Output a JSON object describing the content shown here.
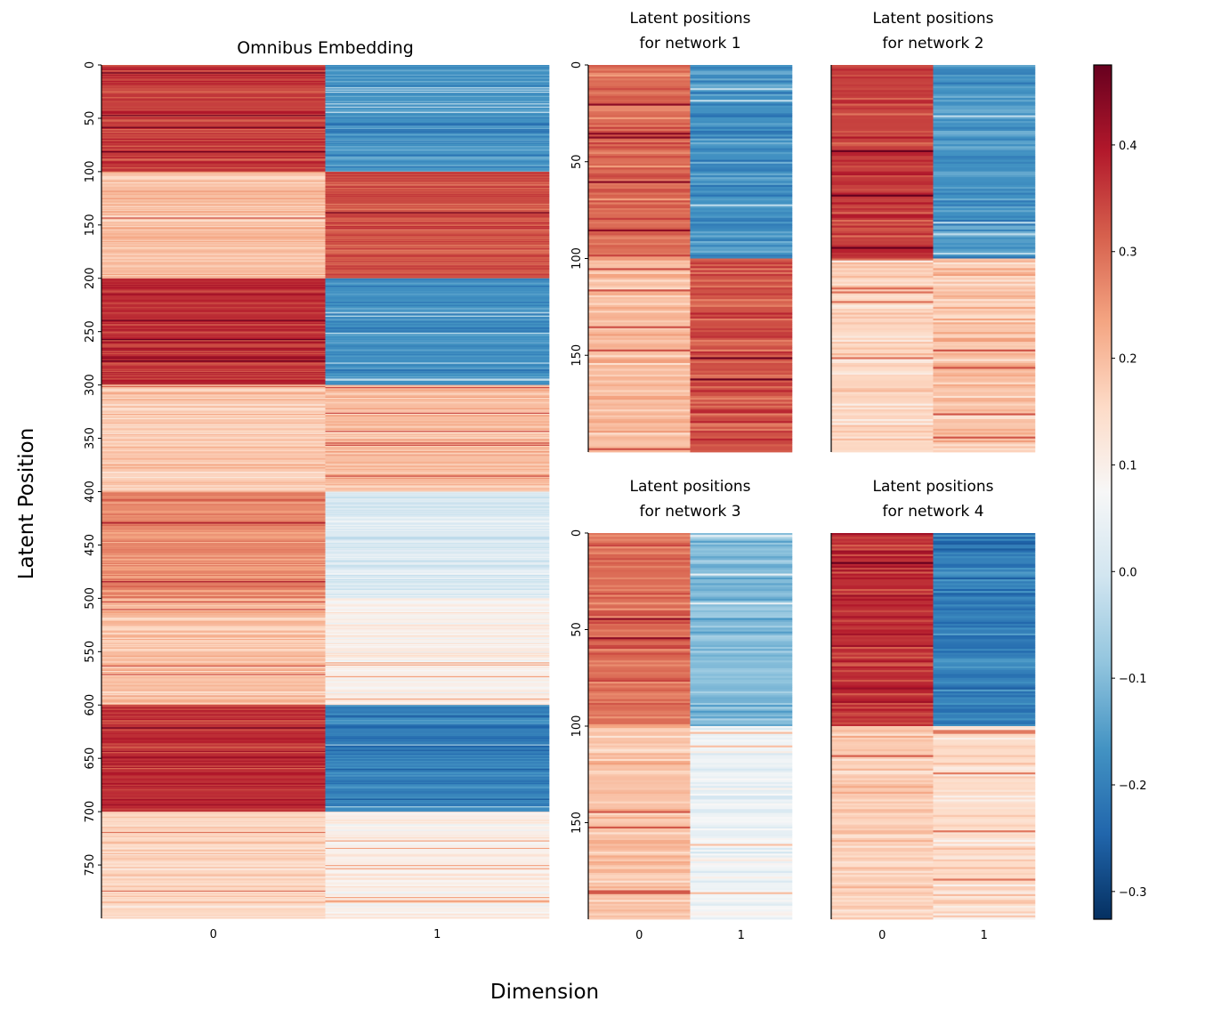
{
  "chart_data": {
    "type": "heatmap",
    "xlabel": "Dimension",
    "ylabel": "Latent Position",
    "colormap": "RdBu_r",
    "colormap_stops": [
      "#053061",
      "#2166ac",
      "#4393c3",
      "#92c5de",
      "#d1e5f0",
      "#f7f7f7",
      "#fddbc7",
      "#f4a582",
      "#d6604d",
      "#b2182b",
      "#67001f"
    ],
    "colorbar": {
      "vmin": -0.326,
      "vmax": 0.475,
      "ticks": [
        -0.3,
        -0.2,
        -0.1,
        0.0,
        0.1,
        0.2,
        0.3,
        0.4
      ],
      "tick_labels": [
        "−0.3",
        "−0.2",
        "−0.1",
        "0.0",
        "0.1",
        "0.2",
        "0.3",
        "0.4"
      ]
    },
    "panels": [
      {
        "id": "omnibus",
        "title_lines": [
          "Omnibus Embedding"
        ],
        "rows": 800,
        "columns": [
          "0",
          "1"
        ],
        "y_ticks": [
          0,
          50,
          100,
          150,
          200,
          250,
          300,
          350,
          400,
          450,
          500,
          550,
          600,
          650,
          700,
          750
        ],
        "show_x_ticks": true,
        "show_y_ticks": true,
        "row_blocks": [
          {
            "rows": [
              0,
              100
            ],
            "mean": [
              0.35,
              -0.17
            ]
          },
          {
            "rows": [
              100,
              200
            ],
            "mean": [
              0.2,
              0.33
            ]
          },
          {
            "rows": [
              200,
              300
            ],
            "mean": [
              0.37,
              -0.17
            ]
          },
          {
            "rows": [
              300,
              400
            ],
            "mean": [
              0.18,
              0.2
            ]
          },
          {
            "rows": [
              400,
              500
            ],
            "mean": [
              0.27,
              0.02
            ]
          },
          {
            "rows": [
              500,
              600
            ],
            "mean": [
              0.2,
              0.1
            ]
          },
          {
            "rows": [
              600,
              700
            ],
            "mean": [
              0.37,
              -0.2
            ]
          },
          {
            "rows": [
              700,
              800
            ],
            "mean": [
              0.16,
              0.1
            ]
          }
        ]
      },
      {
        "id": "net1",
        "title_lines": [
          "Latent positions",
          "for network 1"
        ],
        "rows": 200,
        "columns": [
          "0",
          "1"
        ],
        "y_ticks": [
          0,
          50,
          100,
          150
        ],
        "show_x_ticks": false,
        "show_y_ticks": true,
        "row_blocks": [
          {
            "rows": [
              0,
              100
            ],
            "mean": [
              0.3,
              -0.17
            ]
          },
          {
            "rows": [
              100,
              200
            ],
            "mean": [
              0.2,
              0.33
            ]
          }
        ]
      },
      {
        "id": "net2",
        "title_lines": [
          "Latent positions",
          "for network 2"
        ],
        "rows": 200,
        "columns": [
          "0",
          "1"
        ],
        "y_ticks": [],
        "show_x_ticks": false,
        "show_y_ticks": false,
        "row_blocks": [
          {
            "rows": [
              0,
              100
            ],
            "mean": [
              0.35,
              -0.17
            ]
          },
          {
            "rows": [
              100,
              200
            ],
            "mean": [
              0.16,
              0.19
            ]
          }
        ]
      },
      {
        "id": "net3",
        "title_lines": [
          "Latent positions",
          "for network 3"
        ],
        "rows": 200,
        "columns": [
          "0",
          "1"
        ],
        "y_ticks": [
          0,
          50,
          100,
          150
        ],
        "show_x_ticks": true,
        "show_y_ticks": true,
        "row_blocks": [
          {
            "rows": [
              0,
              100
            ],
            "mean": [
              0.3,
              -0.1
            ]
          },
          {
            "rows": [
              100,
              200
            ],
            "mean": [
              0.19,
              0.06
            ]
          }
        ]
      },
      {
        "id": "net4",
        "title_lines": [
          "Latent positions",
          "for network 4"
        ],
        "rows": 200,
        "columns": [
          "0",
          "1"
        ],
        "y_ticks": [],
        "show_x_ticks": true,
        "show_y_ticks": false,
        "row_blocks": [
          {
            "rows": [
              0,
              100
            ],
            "mean": [
              0.37,
              -0.2
            ]
          },
          {
            "rows": [
              100,
              200
            ],
            "mean": [
              0.18,
              0.15
            ]
          }
        ]
      }
    ]
  }
}
